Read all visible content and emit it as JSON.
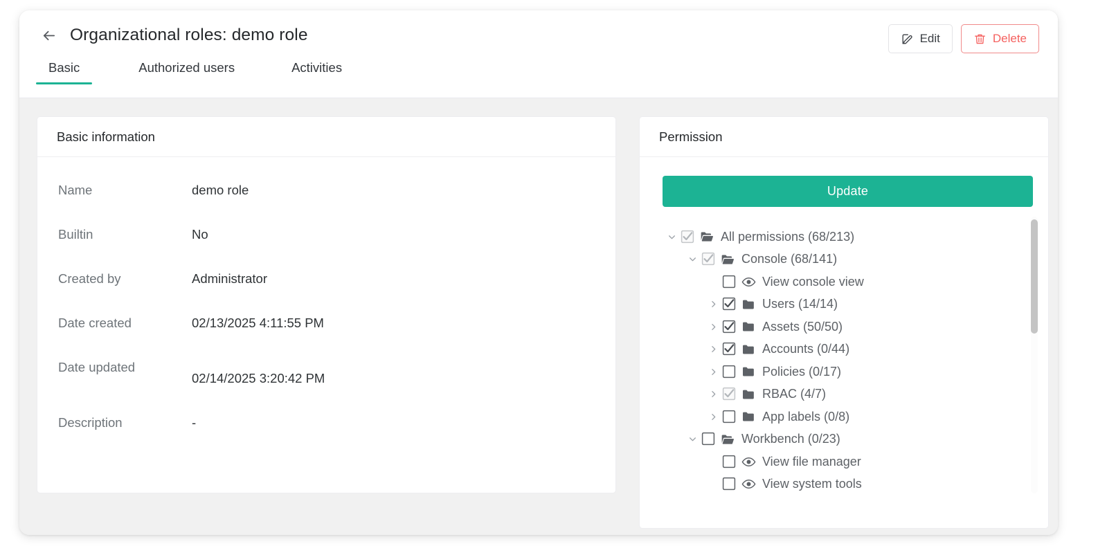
{
  "header": {
    "back_icon": "arrow-left-icon",
    "title": "Organizational roles: demo role",
    "actions": [
      {
        "label": "Edit",
        "icon": "edit-pencil-square-icon",
        "style": "default"
      },
      {
        "label": "Delete",
        "icon": "trash-icon",
        "style": "danger"
      }
    ]
  },
  "tabs": [
    {
      "label": "Basic",
      "active": true
    },
    {
      "label": "Authorized users",
      "active": false
    },
    {
      "label": "Activities",
      "active": false
    }
  ],
  "basic_information": {
    "card_title": "Basic information",
    "rows": [
      {
        "label": "Name",
        "value": "demo role"
      },
      {
        "label": "Builtin",
        "value": "No"
      },
      {
        "label": "Created by",
        "value": "Administrator"
      },
      {
        "label": "Date created",
        "value": "02/13/2025 4:11:55 PM"
      },
      {
        "label": "Date updated",
        "value": "02/14/2025 3:20:42 PM"
      },
      {
        "label": "Description",
        "value": "-"
      }
    ]
  },
  "permission": {
    "card_title": "Permission",
    "update_label": "Update",
    "tree": [
      {
        "label": "All permissions (68/213)",
        "depth": 0,
        "caret": "down",
        "check": "partial",
        "icon": "folder-open-icon"
      },
      {
        "label": "Console (68/141)",
        "depth": 1,
        "caret": "down",
        "check": "partial",
        "icon": "folder-open-icon"
      },
      {
        "label": "View console view",
        "depth": 2,
        "caret": "none",
        "check": "unchecked",
        "icon": "eye-icon"
      },
      {
        "label": "Users (14/14)",
        "depth": 2,
        "caret": "right",
        "check": "checked",
        "icon": "folder-icon"
      },
      {
        "label": "Assets (50/50)",
        "depth": 2,
        "caret": "right",
        "check": "checked",
        "icon": "folder-icon"
      },
      {
        "label": "Accounts (0/44)",
        "depth": 2,
        "caret": "right",
        "check": "checked",
        "icon": "folder-icon"
      },
      {
        "label": "Policies (0/17)",
        "depth": 2,
        "caret": "right",
        "check": "unchecked",
        "icon": "folder-icon"
      },
      {
        "label": "RBAC (4/7)",
        "depth": 2,
        "caret": "right",
        "check": "partial",
        "icon": "folder-icon"
      },
      {
        "label": "App labels (0/8)",
        "depth": 2,
        "caret": "right",
        "check": "unchecked",
        "icon": "folder-icon"
      },
      {
        "label": "Workbench (0/23)",
        "depth": 1,
        "caret": "down",
        "check": "unchecked",
        "icon": "folder-open-icon"
      },
      {
        "label": "View file manager",
        "depth": 2,
        "caret": "none",
        "check": "unchecked",
        "icon": "eye-icon"
      },
      {
        "label": "View system tools",
        "depth": 2,
        "caret": "none",
        "check": "unchecked",
        "icon": "eye-icon"
      }
    ]
  },
  "colors": {
    "accent_green": "#1cb394",
    "danger_red": "#f5615f",
    "page_bg": "#f1f1f1",
    "card_bg": "#ffffff",
    "label_gray": "#6e7479"
  }
}
